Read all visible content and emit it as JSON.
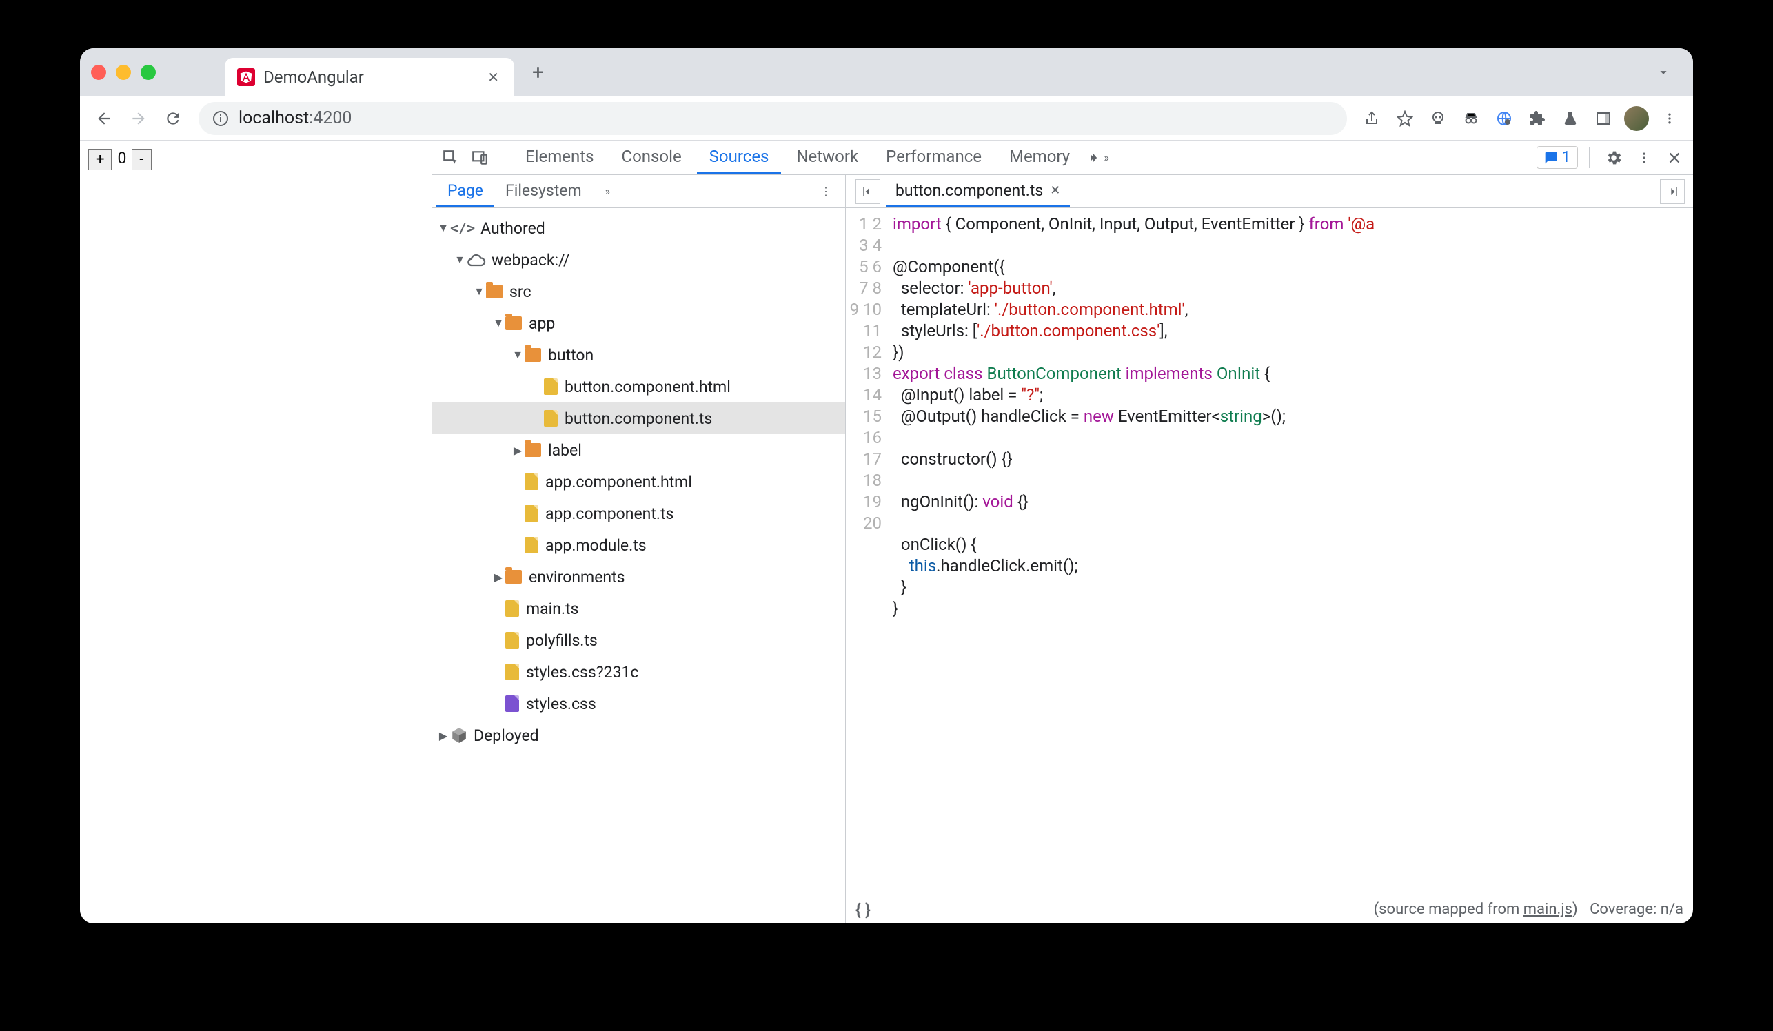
{
  "browser": {
    "tab_title": "DemoAngular",
    "url_host": "localhost",
    "url_port": ":4200"
  },
  "app_page": {
    "plus": "+",
    "count": "0",
    "minus": "-"
  },
  "devtools": {
    "tabs": [
      "Elements",
      "Console",
      "Sources",
      "Network",
      "Performance",
      "Memory"
    ],
    "active_tab": "Sources",
    "issues_count": "1"
  },
  "sources_nav": {
    "tabs": [
      "Page",
      "Filesystem"
    ],
    "active": "Page",
    "tree": {
      "authored": "Authored",
      "webpack": "webpack://",
      "src": "src",
      "app": "app",
      "button": "button",
      "button_html": "button.component.html",
      "button_ts": "button.component.ts",
      "label": "label",
      "app_html": "app.component.html",
      "app_ts": "app.component.ts",
      "app_module": "app.module.ts",
      "environments": "environments",
      "main_ts": "main.ts",
      "polyfills": "polyfills.ts",
      "styles_q": "styles.css?231c",
      "styles": "styles.css",
      "deployed": "Deployed"
    }
  },
  "editor": {
    "filename": "button.component.ts",
    "line_count": 20,
    "code": {
      "l1_import": "import",
      "l1_mid": " { Component, OnInit, Input, Output, EventEmitter } ",
      "l1_from": "from",
      "l1_pkg": " '@a",
      "l3": "@Component({",
      "l4_k": "  selector: ",
      "l4_v": "'app-button'",
      "l4_end": ",",
      "l5_k": "  templateUrl: ",
      "l5_v": "'./button.component.html'",
      "l5_end": ",",
      "l6_k": "  styleUrls: [",
      "l6_v": "'./button.component.css'",
      "l6_end": "],",
      "l7": "})",
      "l8_export": "export",
      "l8_class": " class ",
      "l8_name": "ButtonComponent",
      "l8_impl": " implements ",
      "l8_oninit": "OnInit",
      "l8_end": " {",
      "l9_a": "  @Input() label = ",
      "l9_v": "\"?\"",
      "l9_end": ";",
      "l10_a": "  @Output() handleClick = ",
      "l10_new": "new",
      "l10_b": " EventEmitter<",
      "l10_str": "string",
      "l10_end": ">();",
      "l12": "  constructor() {}",
      "l14_a": "  ngOnInit(): ",
      "l14_void": "void",
      "l14_end": " {}",
      "l16": "  onClick() {",
      "l17_a": "    ",
      "l17_this": "this",
      "l17_b": ".handleClick.emit();",
      "l18": "  }",
      "l19": "}"
    }
  },
  "statusbar": {
    "mapped_pre": "(source mapped from ",
    "mapped_link": "main.js",
    "mapped_post": ")",
    "coverage": "Coverage: n/a"
  }
}
